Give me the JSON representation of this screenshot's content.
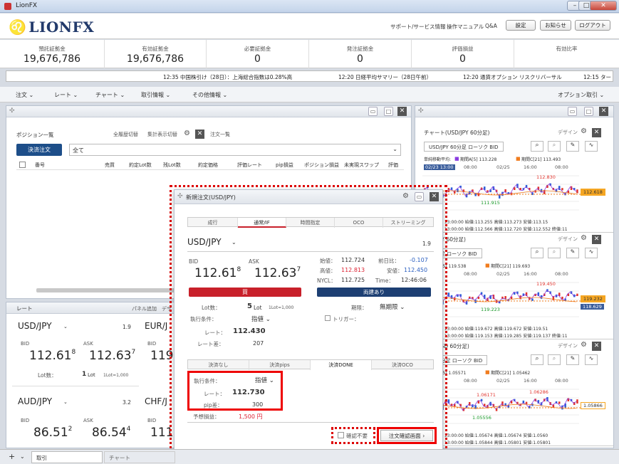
{
  "window": {
    "title": "LionFX",
    "min": "–",
    "restore": "□",
    "close": "✕"
  },
  "header": {
    "logo": "LIONFX",
    "links": [
      "サポート/サービス情報",
      "操作マニュアル",
      "Q&A"
    ],
    "buttons": [
      "設定",
      "お知らせ",
      "ログアウト"
    ]
  },
  "summary": [
    {
      "label": "預託証拠金",
      "value": "19,676,786"
    },
    {
      "label": "有効証拠金",
      "value": "19,676,786"
    },
    {
      "label": "必要証拠金",
      "value": "0"
    },
    {
      "label": "発注証拠金",
      "value": "0"
    },
    {
      "label": "評価損益",
      "value": "0"
    },
    {
      "label": "有効比率",
      "value": ""
    }
  ],
  "ticker": [
    "12:35 中国株引け（28日）：上海総合指数は0.28%高",
    "12:20 日経平均サマリー（28日午前）",
    "12:20 通貨オプション リスクリバーサル",
    "12:15 ター"
  ],
  "menu": {
    "items": [
      "注文",
      "レート",
      "チャート",
      "取引情報",
      "その他情報"
    ],
    "right": "オプション取引"
  },
  "positions": {
    "title": "ポジション一覧",
    "links": [
      "全履歴切替",
      "集計表示切替"
    ],
    "tab2": "注文一覧",
    "settle_btn": "決済注文",
    "filter": "全て",
    "columns": [
      "番号",
      "売買",
      "約定Lot数",
      "残Lot数",
      "約定価格",
      "評価レート",
      "pip損益",
      "ポジション損益",
      "未実現スワップ",
      "評価"
    ]
  },
  "rates": {
    "title": "レート",
    "add": "パネル追加",
    "design": "デザ",
    "tiles": [
      {
        "pair": "USD/JPY",
        "spread": "1.9",
        "bid_label": "BID",
        "ask_label": "ASK",
        "bid_main": "112.61",
        "bid_sup": "8",
        "ask_main": "112.63",
        "ask_sup": "7",
        "lot_label": "Lot数：",
        "lot": "1",
        "lot_unit": "Lot",
        "lot_note": "1Lot=1,000"
      },
      {
        "pair": "EUR/J",
        "bid_label": "BID",
        "bid_main": "119"
      },
      {
        "pair": "AUD/JPY",
        "spread": "3.2",
        "bid_label": "BID",
        "ask_label": "ASK",
        "bid_main": "86.51",
        "bid_sup": "2",
        "ask_main": "86.54",
        "ask_sup": "4"
      },
      {
        "pair": "CHF/J",
        "bid_label": "BID",
        "bid_main": "111"
      }
    ]
  },
  "charts": [
    {
      "title": "チャート(USD/JPY 60分足)",
      "design": "デザイン",
      "selector": "USD/JPY 60分足 ローソク BID",
      "legend": [
        "単純移動平均:",
        "期間A[5] 113.228",
        "期間C[21] 113.493"
      ],
      "date_label": "02/23 13:00",
      "times": [
        "08:00",
        "02/25",
        "16:00",
        "08:00"
      ],
      "hi": "112.830",
      "lo": "111.915",
      "last": "112.618",
      "footer": [
        "17/02/28 13:00:00 始値:113.255 高値:113.273 安値:113.15",
        "17/02/28 13:00:00 始値:112.566 高値:112.720 安値:112.552 終値:11"
      ]
    },
    {
      "title": "EUR/JPY 60分足)",
      "design": "デザイン",
      "selector": "60分足 ローソク BID",
      "legend": [
        "期間A[5] 119.538",
        "期間C[21] 119.693"
      ],
      "times": [
        "08:00",
        "02/25",
        "16:00",
        "08:00"
      ],
      "hi": "119.450",
      "lo": "119.223",
      "last": "119.232",
      "last2": "118.629",
      "footer": [
        "17/02/28 13:00:00 始値:119.672 高値:119.672 安値:119.51",
        "17/02/28 13:00:00 始値:119.153 高値:119.285 安値:119.137 終値:11"
      ]
    },
    {
      "title": "EUR/USD 60分足)",
      "design": "デザイン",
      "selector": "D 60分足 ローソク BID",
      "legend": [
        "期間A[5] 1.05571",
        "期間C[21] 1.05462"
      ],
      "times": [
        "08:00",
        "02/25",
        "16:00",
        "08:00"
      ],
      "hi": "1.06286",
      "hi2": "1.06171",
      "lo": "1.05556",
      "last": "1.05866",
      "footer": [
        "17/02/28 13:00:00 始値:1.05674 高値:1.05674 安値:1.0560",
        "17/02/28 13:00:00 始値:1.05844 高値:1.05801 安値:1.05801"
      ]
    }
  ],
  "order": {
    "title": "新規注文(USD/JPY)",
    "tabs": [
      "成行",
      "通常/IF",
      "時間指定",
      "OCO",
      "ストリーミング"
    ],
    "pair": "USD/JPY",
    "spread": "1.9",
    "bid_label": "BID",
    "ask_label": "ASK",
    "bid_main": "112.61",
    "bid_sup": "8",
    "ask_main": "112.63",
    "ask_sup": "7",
    "stats": [
      {
        "l": "始値：",
        "v": "112.724"
      },
      {
        "l": "前日比：",
        "v": "-0.107"
      },
      {
        "l": "高値：",
        "v": "112.813"
      },
      {
        "l": "安値：",
        "v": "112.450"
      },
      {
        "l": "NYCL：",
        "v": "112.725"
      },
      {
        "l": "Time：",
        "v": "12:46:06"
      }
    ],
    "buy": "買",
    "sell": "両建あり",
    "lot_label": "Lot数：",
    "lot": "5",
    "lot_unit": "Lot",
    "lot_note": "1Lot=1,000",
    "period_label": "期限：",
    "period": "無期限",
    "exec_label": "執行条件：",
    "exec": "指値",
    "trigger": "トリガー：",
    "rate_label": "レート：",
    "rate": "112.430",
    "diff_label": "レート差：",
    "diff": "207",
    "subtabs": [
      "決済なし",
      "決済pips",
      "決済DONE",
      "決済OCO"
    ],
    "s_exec_label": "執行条件：",
    "s_exec": "指値",
    "s_rate_label": "レート：",
    "s_rate": "112.730",
    "s_pip_label": "pip差：",
    "s_pip": "300",
    "pnl_label": "予想損益：",
    "pnl": "1,500 円",
    "confirm_skip": "確認不要",
    "confirm_btn": "注文確認画面"
  },
  "bottom": {
    "tabs": [
      "取引",
      "チャート"
    ]
  }
}
